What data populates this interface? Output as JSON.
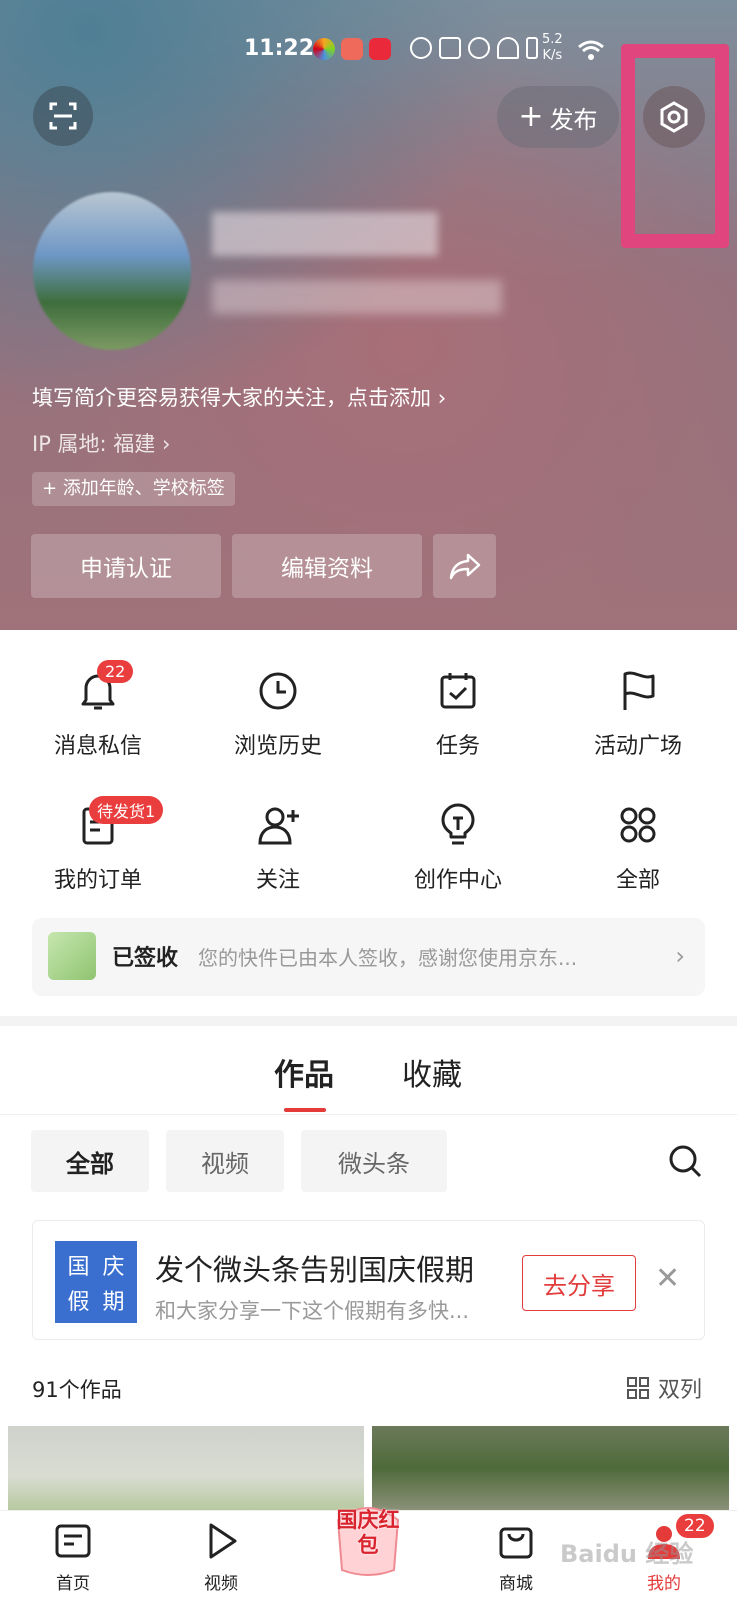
{
  "status_bar": {
    "time": "11:22",
    "speed_value": "5.2",
    "speed_unit": "K/s"
  },
  "header": {
    "publish_label": "发布",
    "bio_prompt": "填写简介更容易获得大家的关注，点击添加",
    "ip_location": "IP 属地: 福建",
    "add_tag_label": "添加年龄、学校标签",
    "verify_button": "申请认证",
    "edit_profile_button": "编辑资料"
  },
  "quick_actions": [
    {
      "label": "消息私信",
      "icon": "bell-icon",
      "badge": "22"
    },
    {
      "label": "浏览历史",
      "icon": "clock-icon"
    },
    {
      "label": "任务",
      "icon": "calendar-check-icon"
    },
    {
      "label": "活动广场",
      "icon": "flag-icon"
    },
    {
      "label": "我的订单",
      "icon": "order-icon",
      "badge": "待发货1"
    },
    {
      "label": "关注",
      "icon": "add-user-icon"
    },
    {
      "label": "创作中心",
      "icon": "lightbulb-icon"
    },
    {
      "label": "全部",
      "icon": "grid-icon"
    }
  ],
  "notice": {
    "title": "已签收",
    "text": "您的快件已由本人签收，感谢您使用京东..."
  },
  "content_tabs": {
    "works": "作品",
    "favorites": "收藏",
    "active": "作品"
  },
  "filters": [
    "全部",
    "视频",
    "微头条"
  ],
  "promo": {
    "image_chars": [
      "国",
      "庆",
      "假",
      "期"
    ],
    "title": "发个微头条告别国庆假期",
    "subtitle": "和大家分享一下这个假期有多快...",
    "button": "去分享"
  },
  "works": {
    "count_label": "91个作品",
    "view_mode": "双列"
  },
  "bottom_nav": {
    "home": "首页",
    "video": "视频",
    "promo_text": "国庆红包",
    "mall": "商城",
    "mine": "我的",
    "mine_badge": "22"
  },
  "watermark": "Baidu 经验",
  "colors": {
    "accent_red": "#e23c3c",
    "highlight_pink": "#e0457d"
  }
}
